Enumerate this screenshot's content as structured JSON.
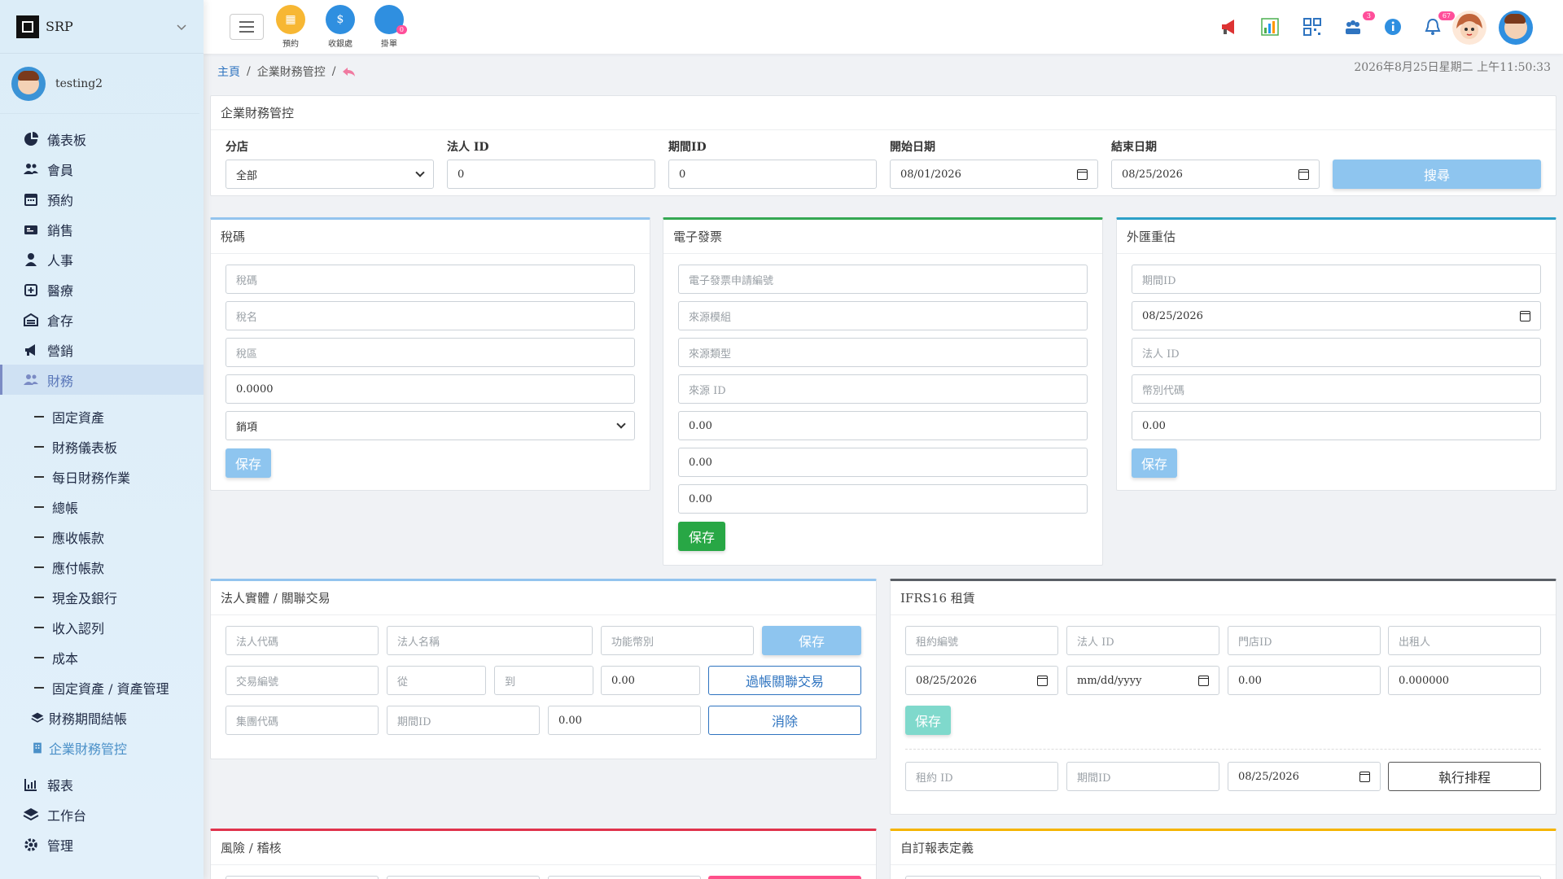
{
  "sidebar": {
    "brand": "SRP",
    "user": "testing2",
    "items": [
      {
        "label": "儀表板",
        "icon": "pie-chart-icon"
      },
      {
        "label": "會員",
        "icon": "users-icon"
      },
      {
        "label": "預約",
        "icon": "calendar-icon"
      },
      {
        "label": "銷售",
        "icon": "cash-icon"
      },
      {
        "label": "人事",
        "icon": "person-icon"
      },
      {
        "label": "醫療",
        "icon": "medical-icon"
      },
      {
        "label": "倉存",
        "icon": "warehouse-icon"
      },
      {
        "label": "營銷",
        "icon": "megaphone-icon"
      },
      {
        "label": "財務",
        "icon": "users-icon"
      }
    ],
    "finance_sub": [
      "固定資產",
      "財務儀表板",
      "每日財務作業",
      "總帳",
      "應收帳款",
      "應付帳款",
      "現金及銀行",
      "收入認列",
      "成本",
      "固定資產 / 資產管理"
    ],
    "finance_sub2": [
      "財務期間結帳",
      "企業財務管控"
    ],
    "bottom_items": [
      {
        "label": "報表",
        "icon": "bar-chart-icon"
      },
      {
        "label": "工作台",
        "icon": "layers-icon"
      },
      {
        "label": "管理",
        "icon": "gear-icon"
      }
    ]
  },
  "topbar": {
    "quick": [
      {
        "label": "預約",
        "color": "#f7b733"
      },
      {
        "label": "收銀處",
        "color": "#2f8fe0"
      },
      {
        "label": "掛單",
        "color": "#2f8fe0",
        "badge": "0"
      }
    ],
    "badge_chat": "3",
    "badge_bell": "67"
  },
  "breadcrumb": {
    "home": "主頁",
    "current": "企業財務管控"
  },
  "datetime": "2026年8月25日星期二 上午11:50:33",
  "filter": {
    "title": "企業財務管控",
    "branch_label": "分店",
    "branch_value": "全部",
    "legal_label": "法人 ID",
    "legal_value": "0",
    "period_label": "期間ID",
    "period_value": "0",
    "start_label": "開始日期",
    "start_value": "08/01/2026",
    "end_label": "結束日期",
    "end_value": "08/25/2026",
    "search": "搜尋"
  },
  "tax": {
    "title": "稅碼",
    "code_ph": "稅碼",
    "name_ph": "稅名",
    "region_ph": "稅區",
    "rate": "0.0000",
    "type": "銷項",
    "save": "保存"
  },
  "einvoice": {
    "title": "電子發票",
    "req_ph": "電子發票申請編號",
    "module_ph": "來源模組",
    "type_ph": "來源類型",
    "source_ph": "來源 ID",
    "v1": "0.00",
    "v2": "0.00",
    "v3": "0.00",
    "save": "保存"
  },
  "fx": {
    "title": "外匯重估",
    "period_ph": "期間ID",
    "date": "08/25/2026",
    "legal_ph": "法人 ID",
    "currency_ph": "幣別代碼",
    "amount": "0.00",
    "save": "保存"
  },
  "entity": {
    "title": "法人實體 / 關聯交易",
    "code_ph": "法人代碼",
    "name_ph": "法人名稱",
    "func_ph": "功能幣別",
    "save": "保存",
    "txn_ph": "交易編號",
    "from_ph": "從",
    "to_ph": "到",
    "amount": "0.00",
    "post": "過帳關聯交易",
    "group_ph": "集團代碼",
    "period_ph": "期間ID",
    "amount2": "0.00",
    "eliminate": "消除"
  },
  "ifrs": {
    "title": "IFRS16 租賃",
    "lease_ph": "租約編號",
    "legal_ph": "法人 ID",
    "store_ph": "門店ID",
    "lessor_ph": "出租人",
    "start": "08/25/2026",
    "end": "mm/dd/yyyy",
    "amount": "0.00",
    "rate": "0.000000",
    "save": "保存",
    "lease_id_ph": "租約 ID",
    "period_ph": "期間ID",
    "date": "08/25/2026",
    "run": "執行排程"
  },
  "risk": {
    "title": "風險 / 稽核"
  },
  "custom": {
    "title": "自訂報表定義"
  }
}
